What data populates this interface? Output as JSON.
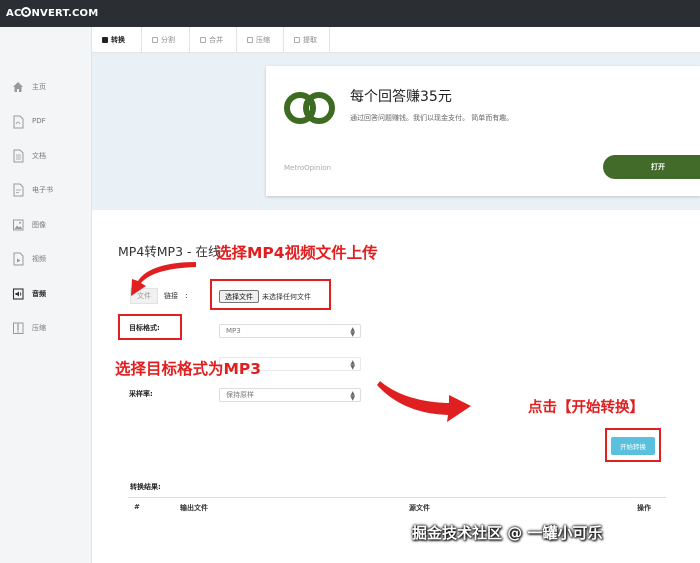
{
  "app": {
    "logo_text_before": "AC",
    "logo_text_after": "NVERT.COM"
  },
  "sidebar": {
    "items": [
      {
        "label": "主页",
        "icon": "home-icon"
      },
      {
        "label": "PDF",
        "icon": "pdf-file-icon"
      },
      {
        "label": "文档",
        "icon": "document-icon"
      },
      {
        "label": "电子书",
        "icon": "ebook-icon"
      },
      {
        "label": "图像",
        "icon": "image-icon"
      },
      {
        "label": "视频",
        "icon": "video-icon"
      },
      {
        "label": "音频",
        "icon": "audio-icon",
        "active": true
      },
      {
        "label": "压缩",
        "icon": "archive-icon"
      }
    ]
  },
  "tabs": [
    {
      "label": "转换",
      "active": true
    },
    {
      "label": "分割"
    },
    {
      "label": "合并"
    },
    {
      "label": "压缩"
    },
    {
      "label": "提取"
    }
  ],
  "ad": {
    "title": "每个回答赚35元",
    "subtitle": "通过回答问题赚钱。我们以现金支付。 简单而有趣。",
    "brand": "MetroOpinion",
    "open_label": "打开",
    "logo_color": "#3d6b22"
  },
  "form": {
    "heading": "MP4转MP3 - 在线",
    "source_tabs": [
      "文件",
      "链接"
    ],
    "colon": ":",
    "choose_file_label": "选择文件",
    "no_file_text": "未选择任何文件",
    "target_format_label": "目标格式:",
    "target_format_value": "MP3",
    "hidden_select_value": "",
    "sample_rate_label": "采样率:",
    "sample_rate_value": "保持原样",
    "convert_label": "开始转换"
  },
  "results": {
    "title": "转换结果:",
    "columns": [
      "#",
      "输出文件",
      "源文件",
      "操作"
    ]
  },
  "annotations": {
    "upload": "选择MP4视频文件上传",
    "format": "选择目标格式为MP3",
    "click": "点击【开始转换】",
    "color": "#e02020"
  },
  "watermark": "掘金技术社区 @ 一罐小可乐"
}
